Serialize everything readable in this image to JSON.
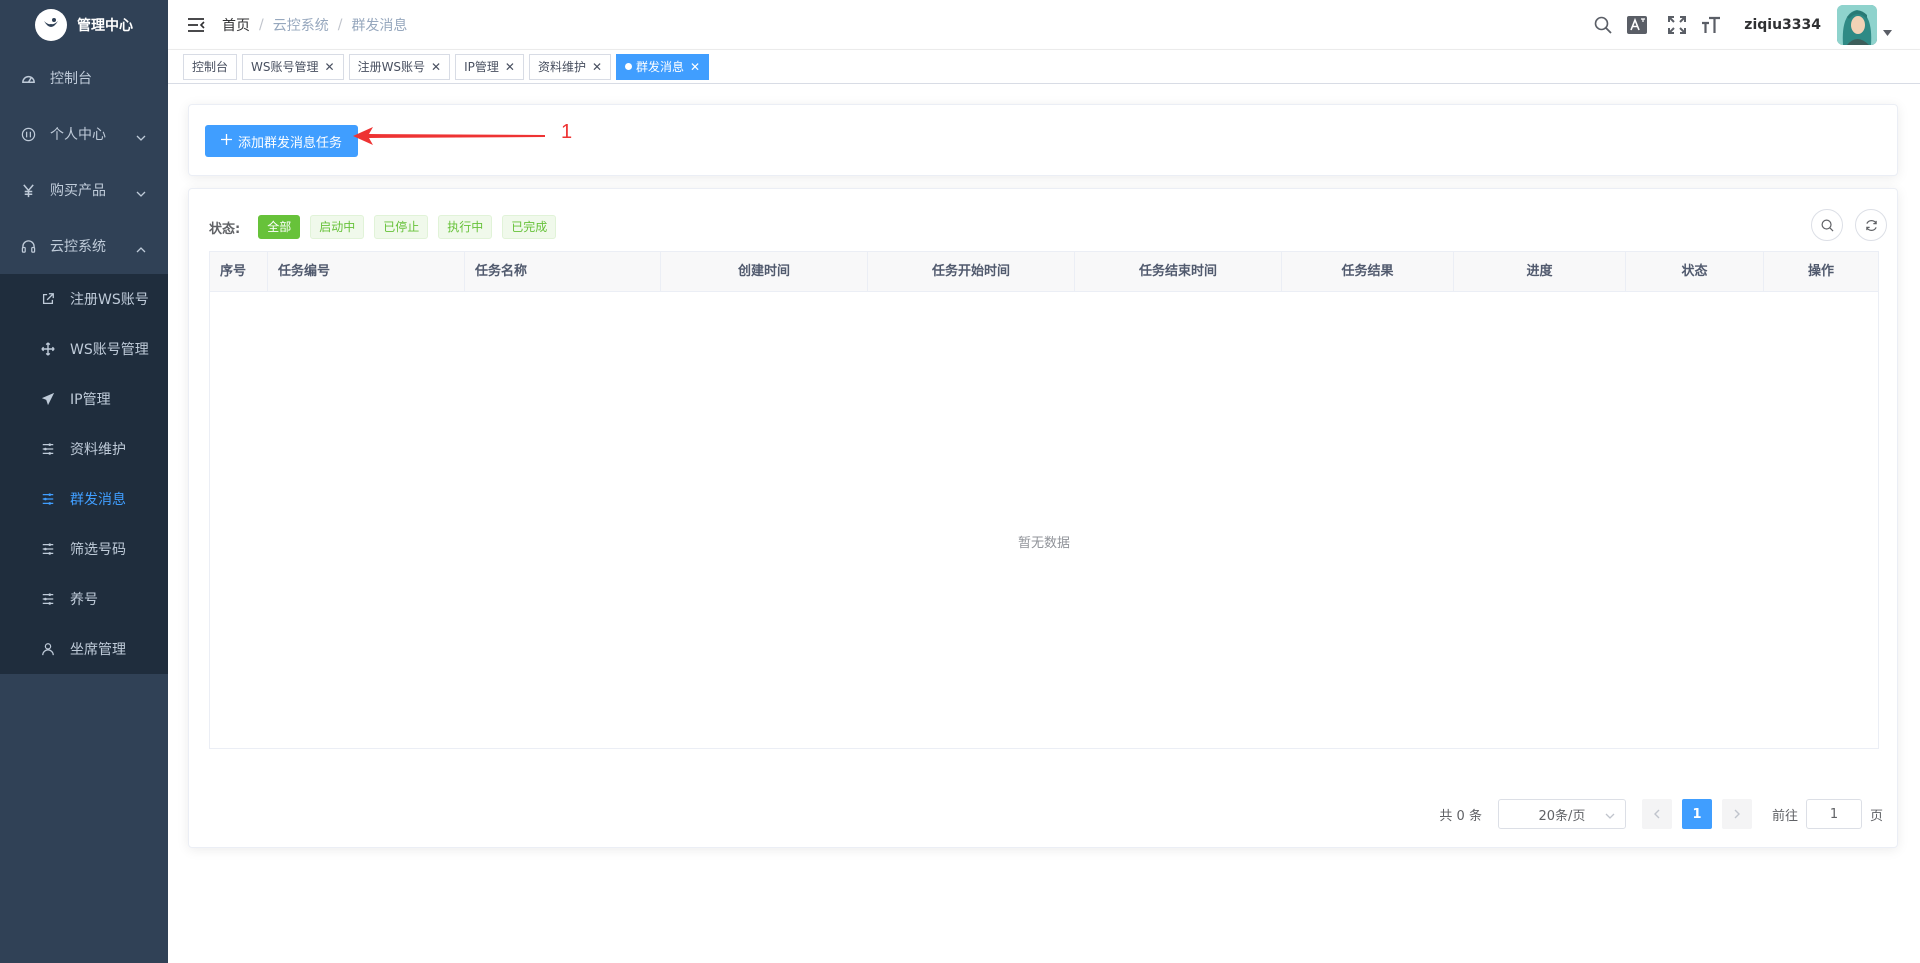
{
  "app": {
    "title": "管理中心"
  },
  "sidebar": {
    "items": [
      {
        "label": "控制台",
        "icon": "dashboard-icon"
      },
      {
        "label": "个人中心",
        "icon": "user-circle-icon",
        "expandable": true
      },
      {
        "label": "购买产品",
        "icon": "yen-icon",
        "expandable": true
      },
      {
        "label": "云控系统",
        "icon": "headset-icon",
        "expanded": true
      }
    ],
    "subitems": [
      {
        "label": "注册WS账号",
        "icon": "external-link-icon"
      },
      {
        "label": "WS账号管理",
        "icon": "move-icon"
      },
      {
        "label": "IP管理",
        "icon": "paper-plane-icon"
      },
      {
        "label": "资料维护",
        "icon": "sliders-icon"
      },
      {
        "label": "群发消息",
        "icon": "sliders-icon",
        "active": true
      },
      {
        "label": "筛选号码",
        "icon": "sliders-icon"
      },
      {
        "label": "养号",
        "icon": "sliders-icon"
      },
      {
        "label": "坐席管理",
        "icon": "person-icon"
      }
    ]
  },
  "header": {
    "breadcrumb": [
      "首页",
      "云控系统",
      "群发消息"
    ],
    "username": "ziqiu3334"
  },
  "tags": [
    {
      "label": "控制台",
      "closable": false
    },
    {
      "label": "WS账号管理",
      "closable": true
    },
    {
      "label": "注册WS账号",
      "closable": true
    },
    {
      "label": "IP管理",
      "closable": true
    },
    {
      "label": "资料维护",
      "closable": true
    },
    {
      "label": "群发消息",
      "closable": true,
      "active": true
    }
  ],
  "toolbar": {
    "add_button": "添加群发消息任务",
    "annotation_number": "1"
  },
  "filter": {
    "label": "状态:",
    "options": [
      "全部",
      "启动中",
      "已停止",
      "执行中",
      "已完成"
    ],
    "selected": "全部"
  },
  "table": {
    "columns": [
      "序号",
      "任务编号",
      "任务名称",
      "创建时间",
      "任务开始时间",
      "任务结束时间",
      "任务结果",
      "进度",
      "状态",
      "操作"
    ],
    "rows": [],
    "empty_text": "暂无数据"
  },
  "pagination": {
    "total_text": "共 0 条",
    "page_size": "20条/页",
    "current_page": "1",
    "goto_label": "前往",
    "goto_value": "1",
    "page_suffix": "页"
  },
  "colors": {
    "sidebar_bg": "#304156",
    "submenu_bg": "#1f2d3d",
    "primary": "#409eff",
    "success": "#67c23a",
    "annotation": "#ee3333"
  }
}
